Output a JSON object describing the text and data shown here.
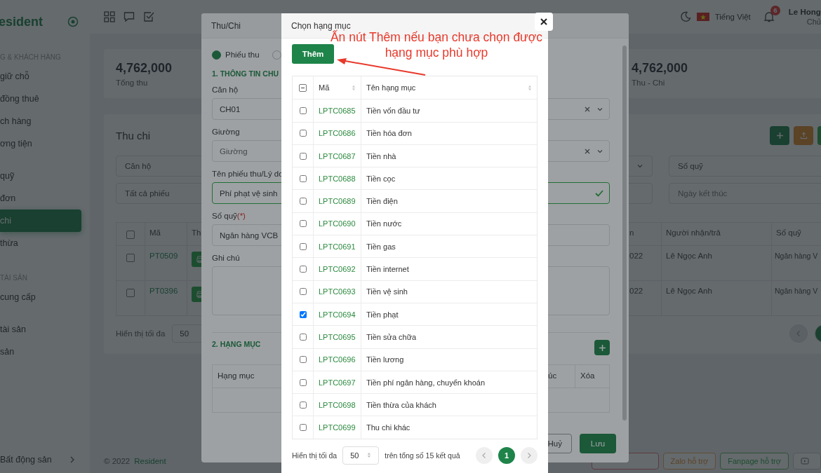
{
  "app": {
    "logo": "esident",
    "sidebar_groups": [
      {
        "heading": "G & KHÁCH HÀNG",
        "items": [
          {
            "label": "giữ chỗ",
            "selected": false
          },
          {
            "label": "đồng thuê",
            "selected": false
          },
          {
            "label": "ch hàng",
            "selected": false
          },
          {
            "label": "ơng tiện",
            "selected": false
          }
        ]
      },
      {
        "items": [
          {
            "label": "quỹ",
            "selected": false
          },
          {
            "label": "đơn",
            "selected": false
          },
          {
            "label": "chi",
            "selected": true
          },
          {
            "label": "thừa",
            "selected": false
          }
        ]
      },
      {
        "heading": "TÀI SẢN",
        "items": [
          {
            "label": "cung cấp",
            "selected": false
          }
        ]
      },
      {
        "items": [
          {
            "label": "tài sản",
            "selected": false
          },
          {
            "label": "sản",
            "selected": false
          }
        ]
      }
    ],
    "sidebar_footer": "Bất động sản",
    "header": {
      "language": "Tiếng Việt",
      "notifications": "6",
      "user_name": "Le Hong",
      "user_role": "Chủ"
    },
    "stats": [
      {
        "value": "4,762,000",
        "label": "Tổng thu"
      },
      {
        "value": "4,762,000",
        "label": "Thu - Chi"
      }
    ],
    "panel": {
      "title": "Thu chi",
      "filters": [
        {
          "kind": "select",
          "text": "Căn hộ"
        },
        {
          "kind": "select"
        },
        {
          "kind": "select",
          "text": "Số quỹ"
        },
        {
          "kind": "select",
          "text": "Tất cả phiếu"
        },
        {
          "kind": "date"
        },
        {
          "kind": "date",
          "placeholder": "Ngày kết thúc"
        }
      ],
      "all_checked": false,
      "columns": [
        "Mã",
        "Th",
        "n",
        "Người nhận/trả",
        "Số quỹ"
      ],
      "rows": [
        {
          "code": "PT0509",
          "date": "022",
          "person": "Lê Ngọc Anh",
          "fund": "Ngân hàng V",
          "checked": false
        },
        {
          "code": "PT0396",
          "date": "022",
          "person": "Lê Ngọc Anh",
          "fund": "Ngân hàng V",
          "checked": false
        }
      ],
      "page_size_label": "Hiển thị tối đa",
      "page_size": "50"
    },
    "footer": {
      "copyright": "© 2022",
      "brand": "Resident",
      "support": [
        {
          "kind": "zalo",
          "label": "Zalo hỗ trợ"
        },
        {
          "kind": "fanpage",
          "label": "Fanpage hỗ trợ"
        }
      ]
    }
  },
  "voucher_dialog": {
    "title": "Thu/Chi",
    "radios": [
      {
        "label": "Phiếu thu",
        "selected": true
      },
      {
        "selected": false
      }
    ],
    "section_1": "1. THÔNG TIN CHU",
    "fields": [
      {
        "kind": "select",
        "label": "Căn hộ",
        "value": "CH01"
      },
      {
        "kind": "select",
        "label": "Giường",
        "placeholder": "Giường"
      },
      {
        "kind": "text",
        "label": "Tên phiếu thu/Lý do",
        "value": "Phí phạt vệ sinh",
        "valid": true
      },
      {
        "kind": "text",
        "label": "Số quỹ",
        "required_mark": "(*)",
        "value": "Ngân hàng VCB",
        "valid": false
      },
      {
        "kind": "textarea",
        "label": "Ghi chú"
      }
    ],
    "section_2": "2. HẠNG MỤC",
    "item_columns": [
      "Hạng mục",
      "úc",
      "Xóa"
    ],
    "buttons": {
      "cancel": "Huỷ",
      "save": "Lưu"
    }
  },
  "picker_dialog": {
    "title": "Chọn hạng mục",
    "add_button": "Thêm",
    "header_checkbox_indeterminate": true,
    "columns": [
      "Mã",
      "Tên hạng mục"
    ],
    "rows": [
      {
        "code": "LPTC0685",
        "name": "Tiền vốn đầu tư",
        "checked": false
      },
      {
        "code": "LPTC0686",
        "name": "Tiền hóa đơn",
        "checked": false
      },
      {
        "code": "LPTC0687",
        "name": "Tiền nhà",
        "checked": false
      },
      {
        "code": "LPTC0688",
        "name": "Tiền cọc",
        "checked": false
      },
      {
        "code": "LPTC0689",
        "name": "Tiền điện",
        "checked": false
      },
      {
        "code": "LPTC0690",
        "name": "Tiền nước",
        "checked": false
      },
      {
        "code": "LPTC0691",
        "name": "Tiền gas",
        "checked": false
      },
      {
        "code": "LPTC0692",
        "name": "Tiền internet",
        "checked": false
      },
      {
        "code": "LPTC0693",
        "name": "Tiền vệ sinh",
        "checked": false
      },
      {
        "code": "LPTC0694",
        "name": "Tiền phạt",
        "checked": true
      },
      {
        "code": "LPTC0695",
        "name": "Tiền sửa chữa",
        "checked": false
      },
      {
        "code": "LPTC0696",
        "name": "Tiền lương",
        "checked": false
      },
      {
        "code": "LPTC0697",
        "name": "Tiền phí ngân hàng, chuyển khoán",
        "checked": false
      },
      {
        "code": "LPTC0698",
        "name": "Tiền thừa của khách",
        "checked": false
      },
      {
        "code": "LPTC0699",
        "name": "Thu chi khác",
        "checked": false
      }
    ],
    "page_size_label": "Hiển thị tối đa",
    "page_size": "50",
    "total": "trên tổng số 15 kết quả",
    "pages": [
      {
        "label": "1",
        "selected": true
      }
    ]
  },
  "annotation": {
    "lines": [
      "Ấn nút Thêm nếu bạn chưa chọn được",
      "hạng mục phù hợp"
    ]
  }
}
